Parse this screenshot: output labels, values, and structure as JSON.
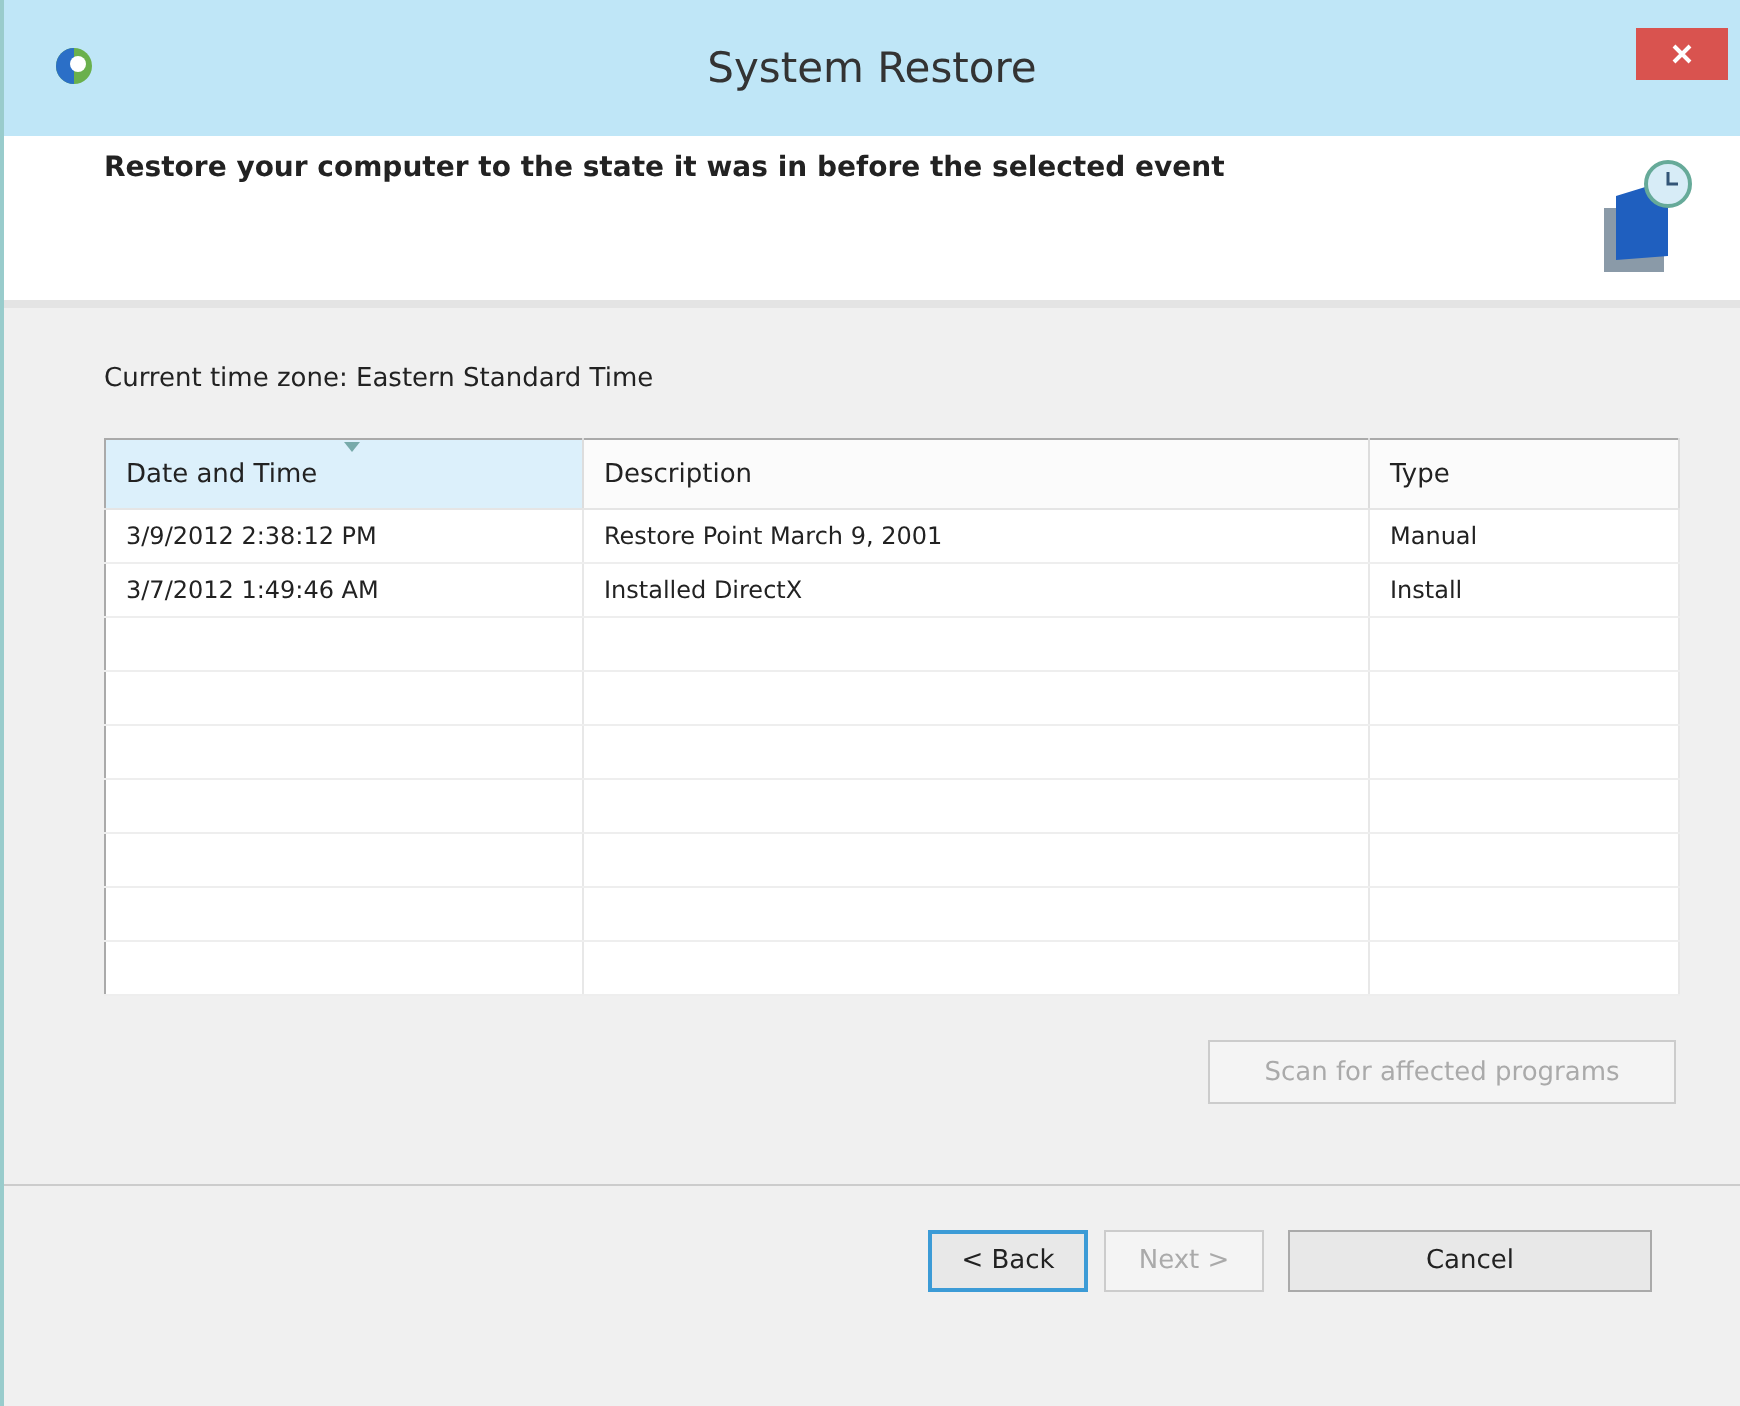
{
  "window": {
    "title": "System Restore"
  },
  "header": {
    "heading": "Restore your computer to the state it was in before the selected event"
  },
  "time_zone": "Current time zone: Eastern Standard Time",
  "table": {
    "columns": [
      {
        "label": "Date and Time",
        "sorted": true
      },
      {
        "label": "Description",
        "sorted": false
      },
      {
        "label": "Type",
        "sorted": false
      }
    ],
    "rows": [
      [
        "3/9/2012 2:38:12 PM",
        "Restore Point March 9, 2001",
        "Manual"
      ],
      [
        "3/7/2012 1:49:46 AM",
        "Installed DirectX",
        "Install"
      ]
    ]
  },
  "scan_button": {
    "label": "Scan for affected programs",
    "disabled": true
  },
  "buttons": [
    {
      "label": "< Back",
      "disabled": false,
      "default": true
    },
    {
      "label": "Next >",
      "disabled": true,
      "default": false
    },
    {
      "label": "Cancel",
      "disabled": false,
      "default": false
    }
  ]
}
